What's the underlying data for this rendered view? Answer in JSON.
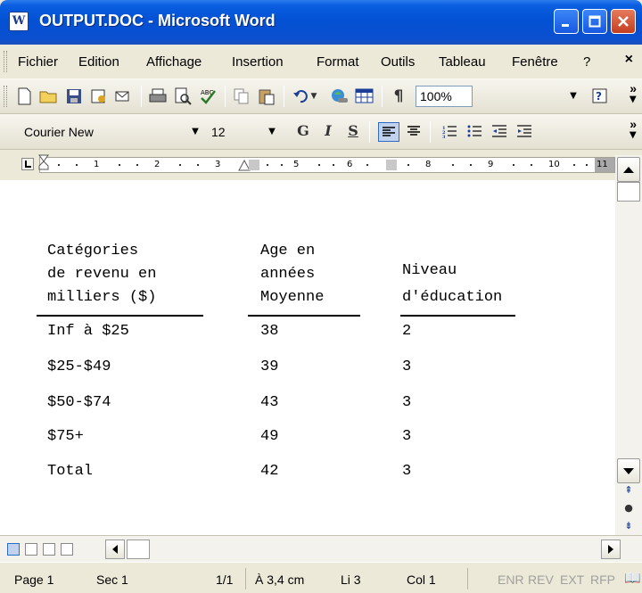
{
  "window": {
    "title": "OUTPUT.DOC - Microsoft Word",
    "app_icon_letter": "W"
  },
  "menu": {
    "items": [
      "Fichier",
      "Edition",
      "Affichage",
      "Insertion",
      "Format",
      "Outils",
      "Tableau",
      "Fenêtre",
      "?"
    ],
    "close_glyph": "×"
  },
  "toolbar_standard": {
    "zoom": "100%"
  },
  "toolbar_format": {
    "font_name": "Courier New",
    "font_size": "12",
    "bold_label": "G",
    "italic_label": "I",
    "underline_label": "S"
  },
  "ruler": {
    "labels": [
      "1",
      "2",
      "3",
      "5",
      "6",
      "8",
      "9",
      "10",
      "11"
    ]
  },
  "document": {
    "headers": {
      "col1": [
        "Catégories",
        "de revenu en",
        "milliers ($)"
      ],
      "col2": [
        "Age en",
        "années",
        "Moyenne"
      ],
      "col3": [
        "Niveau",
        "d'éducation"
      ]
    },
    "rows": [
      {
        "category": "Inf à $25",
        "age": "38",
        "education": "2"
      },
      {
        "category": "$25-$49",
        "age": "39",
        "education": "3"
      },
      {
        "category": "$50-$74",
        "age": "43",
        "education": "3"
      },
      {
        "category": "$75+",
        "age": "49",
        "education": "3"
      },
      {
        "category": "Total",
        "age": "42",
        "education": "3"
      }
    ]
  },
  "statusbar": {
    "page": "Page 1",
    "section": "Sec 1",
    "pages": "1/1",
    "position": "À 3,4 cm",
    "line": "Li 3",
    "column": "Col 1",
    "modes": [
      "ENR",
      "REV",
      "EXT",
      "RFP"
    ]
  },
  "colors": {
    "titlebar": "#0451d4",
    "chrome": "#ece9d8",
    "close_button": "#c43f20"
  }
}
